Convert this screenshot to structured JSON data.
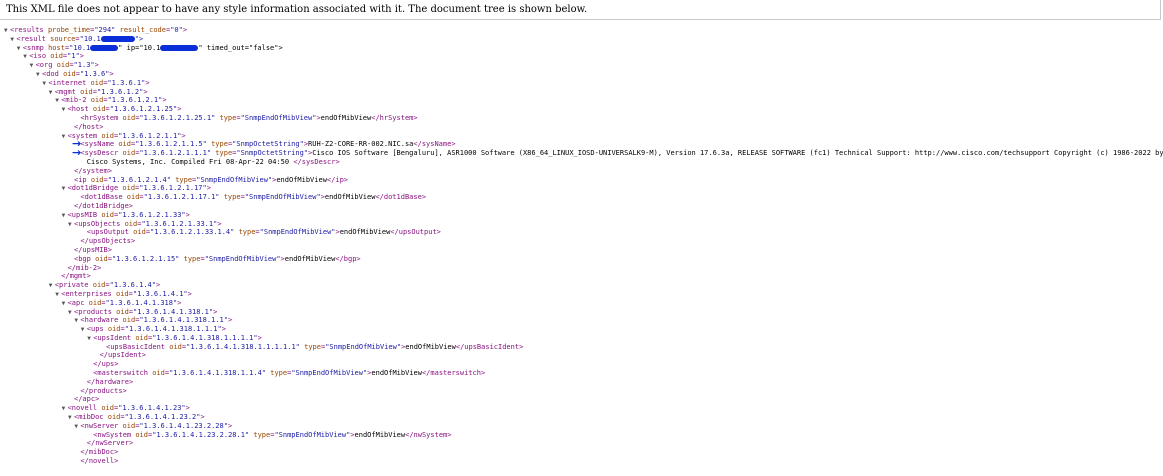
{
  "banner": {
    "text": "This XML file does not appear to have any style information associated with it. The document tree is shown below."
  },
  "lines": [
    {
      "i": 0,
      "t": "▼",
      "h": "<results probe_time=\"294\" result_code=\"0\">"
    },
    {
      "i": 1,
      "t": "▼",
      "h": "<result source=\"10.1"
    },
    {
      "i": 2,
      "t": "▼",
      "h": "<snmp host=\"10.1"
    },
    {
      "i": 3,
      "t": "▼",
      "h": "<iso oid=\"1\">"
    },
    {
      "i": 4,
      "t": "▼",
      "h": "<org oid=\"1.3\">"
    },
    {
      "i": 5,
      "t": "▼",
      "h": "<dod oid=\"1.3.6\">"
    },
    {
      "i": 6,
      "t": "▼",
      "h": "<internet oid=\"1.3.6.1\">"
    },
    {
      "i": 7,
      "t": "▼",
      "h": "<mgmt oid=\"1.3.6.1.2\">"
    },
    {
      "i": 8,
      "t": "▼",
      "h": "<mib-2 oid=\"1.3.6.1.2.1\">"
    },
    {
      "i": 9,
      "t": "▼",
      "h": "<host oid=\"1.3.6.1.2.1.25\">"
    },
    {
      "i": 11,
      "t": "",
      "h": "<hrSystem oid=\"1.3.6.1.2.1.25.1\" type=\"SnmpEndOfMibView\">endOfMibView</hrSystem>"
    },
    {
      "i": 10,
      "t": "",
      "h": "</host>"
    },
    {
      "i": 9,
      "t": "▼",
      "h": "<system oid=\"1.3.6.1.2.1.1\">"
    },
    {
      "i": 11,
      "t": "",
      "h": "<sysName oid=\"1.3.6.1.2.1.1.5\" type=\"SnmpOctetString\">RUH-Z2-CORE-RR-002.NIC.sa</sysName>"
    },
    {
      "i": 11,
      "t": "",
      "h": "<sysDescr oid=\"1.3.6.1.2.1.1.1\" type=\"SnmpOctetString\">Cisco IOS Software [Bengaluru], ASR1000 Software (X86_64_LINUX_IOSD-UNIVERSALK9-M), Version 17.6.3a, RELEASE SOFTWARE (fc1) Technical Support: http://www.cisco.com/techsupport Copyright (c) 1986-2022 by"
    },
    {
      "i": 12,
      "t": "",
      "h": "Cisco Systems, Inc. Compiled Fri 08-Apr-22 04:50 </sysDescr>"
    },
    {
      "i": 10,
      "t": "",
      "h": "</system>"
    },
    {
      "i": 10,
      "t": "",
      "h": "<ip oid=\"1.3.6.1.2.1.4\" type=\"SnmpEndOfMibView\">endOfMibView</ip>"
    },
    {
      "i": 9,
      "t": "▼",
      "h": "<dot1dBridge oid=\"1.3.6.1.2.1.17\">"
    },
    {
      "i": 11,
      "t": "",
      "h": "<dot1dBase oid=\"1.3.6.1.2.1.17.1\" type=\"SnmpEndOfMibView\">endOfMibView</dot1dBase>"
    },
    {
      "i": 10,
      "t": "",
      "h": "</dot1dBridge>"
    },
    {
      "i": 9,
      "t": "▼",
      "h": "<upsMIB oid=\"1.3.6.1.2.1.33\">"
    },
    {
      "i": 10,
      "t": "▼",
      "h": "<upsObjects oid=\"1.3.6.1.2.1.33.1\">"
    },
    {
      "i": 12,
      "t": "",
      "h": "<upsOutput oid=\"1.3.6.1.2.1.33.1.4\" type=\"SnmpEndOfMibView\">endOfMibView</upsOutput>"
    },
    {
      "i": 11,
      "t": "",
      "h": "</upsObjects>"
    },
    {
      "i": 10,
      "t": "",
      "h": "</upsMIB>"
    },
    {
      "i": 10,
      "t": "",
      "h": "<bgp oid=\"1.3.6.1.2.1.15\" type=\"SnmpEndOfMibView\">endOfMibView</bgp>"
    },
    {
      "i": 9,
      "t": "",
      "h": "</mib-2>"
    },
    {
      "i": 8,
      "t": "",
      "h": "</mgmt>"
    },
    {
      "i": 7,
      "t": "▼",
      "h": "<private oid=\"1.3.6.1.4\">"
    },
    {
      "i": 8,
      "t": "▼",
      "h": "<enterprises oid=\"1.3.6.1.4.1\">"
    },
    {
      "i": 9,
      "t": "▼",
      "h": "<apc oid=\"1.3.6.1.4.1.318\">"
    },
    {
      "i": 10,
      "t": "▼",
      "h": "<products oid=\"1.3.6.1.4.1.318.1\">"
    },
    {
      "i": 11,
      "t": "▼",
      "h": "<hardware oid=\"1.3.6.1.4.1.318.1.1\">"
    },
    {
      "i": 12,
      "t": "▼",
      "h": "<ups oid=\"1.3.6.1.4.1.318.1.1.1\">"
    },
    {
      "i": 13,
      "t": "▼",
      "h": "<upsIdent oid=\"1.3.6.1.4.1.318.1.1.1.1\">"
    },
    {
      "i": 15,
      "t": "",
      "h": "<upsBasicIdent oid=\"1.3.6.1.4.1.318.1.1.1.1.1\" type=\"SnmpEndOfMibView\">endOfMibView</upsBasicIdent>"
    },
    {
      "i": 14,
      "t": "",
      "h": "</upsIdent>"
    },
    {
      "i": 13,
      "t": "",
      "h": "</ups>"
    },
    {
      "i": 13,
      "t": "",
      "h": "<masterswitch oid=\"1.3.6.1.4.1.318.1.1.4\" type=\"SnmpEndOfMibView\">endOfMibView</masterswitch>"
    },
    {
      "i": 12,
      "t": "",
      "h": "</hardware>"
    },
    {
      "i": 11,
      "t": "",
      "h": "</products>"
    },
    {
      "i": 10,
      "t": "",
      "h": "</apc>"
    },
    {
      "i": 9,
      "t": "▼",
      "h": "<novell oid=\"1.3.6.1.4.1.23\">"
    },
    {
      "i": 10,
      "t": "▼",
      "h": "<mibDoc oid=\"1.3.6.1.4.1.23.2\">"
    },
    {
      "i": 11,
      "t": "▼",
      "h": "<nwServer oid=\"1.3.6.1.4.1.23.2.28\">"
    },
    {
      "i": 13,
      "t": "",
      "h": "<nwSystem oid=\"1.3.6.1.4.1.23.2.28.1\" type=\"SnmpEndOfMibView\">endOfMibView</nwSystem>"
    },
    {
      "i": 12,
      "t": "",
      "h": "</nwServer>"
    },
    {
      "i": 11,
      "t": "",
      "h": "</mibDoc>"
    },
    {
      "i": 11,
      "t": "",
      "h": "</novell>"
    }
  ],
  "snmp_tail_ip_label": "\" ip=\"10.1",
  "snmp_tail_end": "\" timed_out=\"false\">",
  "result_tail_end": "\">",
  "annotations": {
    "arrow_color": "#0a2fd8",
    "redaction_color": "#0a2fd8"
  }
}
